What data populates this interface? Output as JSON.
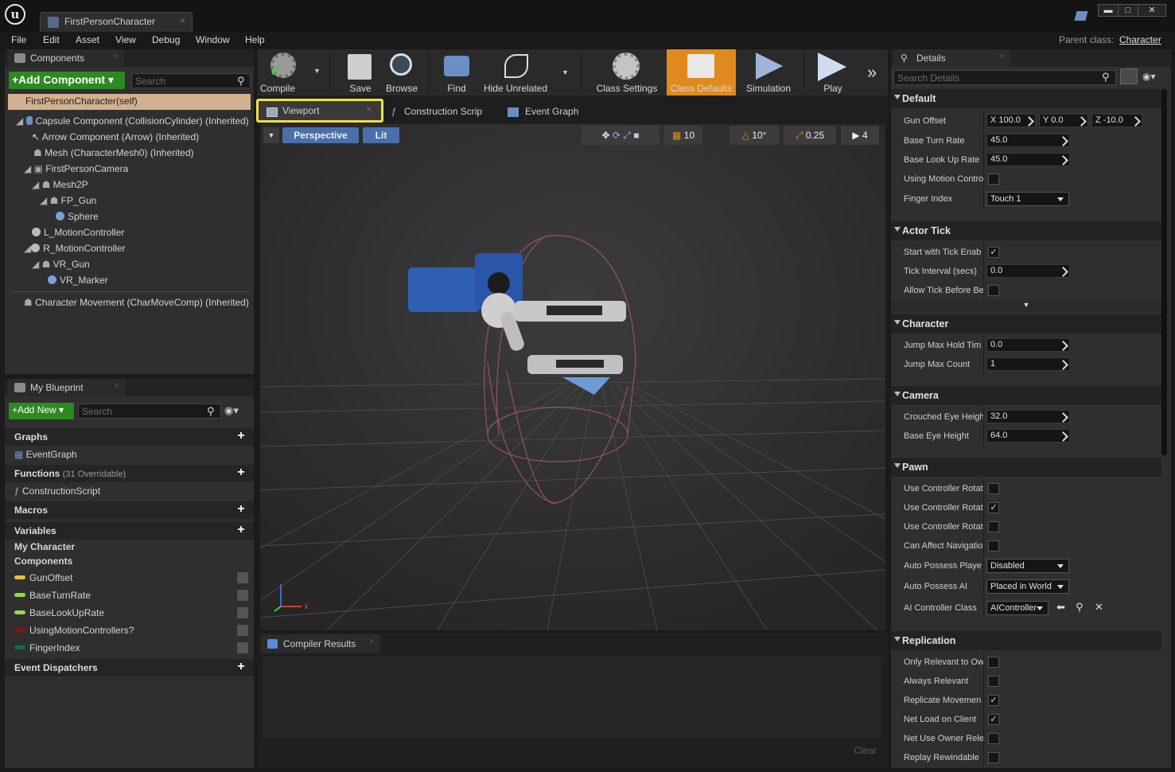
{
  "window": {
    "tab_title": "FirstPersonCharacter",
    "tab_close": "×",
    "parent_class_label": "Parent class:",
    "parent_class_value": "Character",
    "minimize": "▬",
    "maximize": "□",
    "close": "✕"
  },
  "menu": [
    "File",
    "Edit",
    "Asset",
    "View",
    "Debug",
    "Window",
    "Help"
  ],
  "components_panel": {
    "tab": "Components",
    "add_button": "+Add Component ▾",
    "search_placeholder": "Search",
    "root": "FirstPersonCharacter(self)",
    "items": [
      "Capsule Component (CollisionCylinder) (Inherited)",
      "Arrow Component (Arrow) (Inherited)",
      "Mesh (CharacterMesh0) (Inherited)",
      "FirstPersonCamera",
      "Mesh2P",
      "FP_Gun",
      "Sphere",
      "L_MotionController",
      "R_MotionController",
      "VR_Gun",
      "VR_Marker",
      "Character Movement (CharMoveComp) (Inherited)"
    ]
  },
  "my_blueprint": {
    "tab": "My Blueprint",
    "add_button": "+Add New ▾",
    "search_placeholder": "Search",
    "graphs": "Graphs",
    "event_graph": "EventGraph",
    "functions": "Functions",
    "functions_count": "(31 Overridable)",
    "construction_script": "ConstructionScript",
    "macros": "Macros",
    "variables": "Variables",
    "my_character": "My Character",
    "components": "Components",
    "vars": [
      {
        "name": "GunOffset",
        "color": "#e3c23a"
      },
      {
        "name": "BaseTurnRate",
        "color": "#8ee03c"
      },
      {
        "name": "BaseLookUpRate",
        "color": "#8ee03c"
      },
      {
        "name": "UsingMotionControllers?",
        "color": "#8a1212"
      },
      {
        "name": "FingerIndex",
        "color": "#0f6b5c"
      }
    ],
    "event_dispatchers": "Event Dispatchers"
  },
  "toolbar": {
    "compile": "Compile",
    "save": "Save",
    "browse": "Browse",
    "find": "Find",
    "hide_unrelated": "Hide Unrelated",
    "class_settings": "Class Settings",
    "class_defaults": "Class Defaults",
    "simulation": "Simulation",
    "play": "Play",
    "more": "»"
  },
  "editor_tabs": {
    "viewport": "Viewport",
    "construction": "Construction Scrip",
    "event_graph": "Event Graph"
  },
  "viewport": {
    "perspective": "Perspective",
    "lit": "Lit",
    "grid_snap": "10",
    "rot_snap": "10°",
    "scale_snap": "0.25",
    "cam_speed": "4"
  },
  "compiler": {
    "tab": "Compiler Results",
    "clear": "Clear"
  },
  "details": {
    "tab": "Details",
    "search_placeholder": "Search Details",
    "default": "Default",
    "gun_offset": "Gun Offset",
    "gun_x": "X  100.0",
    "gun_y": "Y  0.0",
    "gun_z": "Z  -10.0",
    "base_turn_rate": "Base Turn Rate",
    "base_turn_rate_v": "45.0",
    "base_look_up_rate": "Base Look Up Rate",
    "base_look_up_rate_v": "45.0",
    "using_motion": "Using Motion Contro",
    "finger_index": "Finger Index",
    "finger_index_v": "Touch 1",
    "actor_tick": "Actor Tick",
    "start_tick": "Start with Tick Enab",
    "tick_interval": "Tick Interval (secs)",
    "tick_interval_v": "0.0",
    "allow_tick": "Allow Tick Before Be",
    "character": "Character",
    "jump_hold": "Jump Max Hold Tim",
    "jump_hold_v": "0.0",
    "jump_count": "Jump Max Count",
    "jump_count_v": "1",
    "camera": "Camera",
    "crouched": "Crouched Eye Heigh",
    "crouched_v": "32.0",
    "base_eye": "Base Eye Height",
    "base_eye_v": "64.0",
    "pawn": "Pawn",
    "ucr1": "Use Controller Rotat",
    "ucr2": "Use Controller Rotat",
    "ucr3": "Use Controller Rotat",
    "can_affect": "Can Affect Navigatio",
    "auto_possess_player": "Auto Possess Playe",
    "auto_possess_player_v": "Disabled",
    "auto_possess_ai": "Auto Possess AI",
    "auto_possess_ai_v": "Placed in World",
    "ai_controller": "AI Controller Class",
    "ai_controller_v": "AIController",
    "replication": "Replication",
    "only_relevant": "Only Relevant to Ow",
    "always_relevant": "Always Relevant",
    "replicate_movement": "Replicate Movemen",
    "net_load": "Net Load on Client",
    "net_use_owner": "Net Use Owner Rele",
    "replay_rewindable": "Replay Rewindable"
  }
}
